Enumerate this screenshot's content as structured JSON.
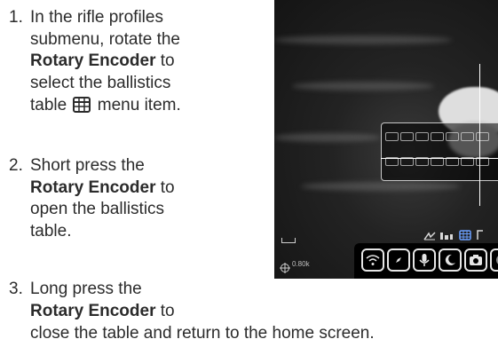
{
  "steps": [
    {
      "number": "1.",
      "lines": [
        {
          "text": "In the rifle profiles"
        },
        {
          "text": "submenu, rotate the"
        },
        {
          "bold": "Rotary Encoder",
          "text": " to"
        },
        {
          "text": "select the ballistics"
        },
        {
          "pre": "table ",
          "icon": "ballistics-table-icon",
          "text": " menu item."
        }
      ]
    },
    {
      "number": "2.",
      "lines": [
        {
          "text": "Short press the"
        },
        {
          "bold": "Rotary Encoder",
          "text": " to"
        },
        {
          "text": "open the ballistics"
        },
        {
          "text": "table."
        }
      ]
    },
    {
      "number": "3.",
      "lines": [
        {
          "text": "Long press the"
        },
        {
          "bold": "Rotary Encoder",
          "text": " to"
        },
        {
          "text": "close the table and return to the home screen."
        }
      ]
    }
  ],
  "device_screen": {
    "zoom_readout": "0.80k",
    "menu_icons": [
      "wifi-icon",
      "compass-icon",
      "microphone-icon",
      "night-mode-icon",
      "camera-icon",
      "gallery-icon"
    ]
  },
  "colors": {
    "text": "#2b2b2b",
    "screen_background": "#1c1c1c",
    "overlay": "#ffffff",
    "menu_bar": "#000000"
  }
}
